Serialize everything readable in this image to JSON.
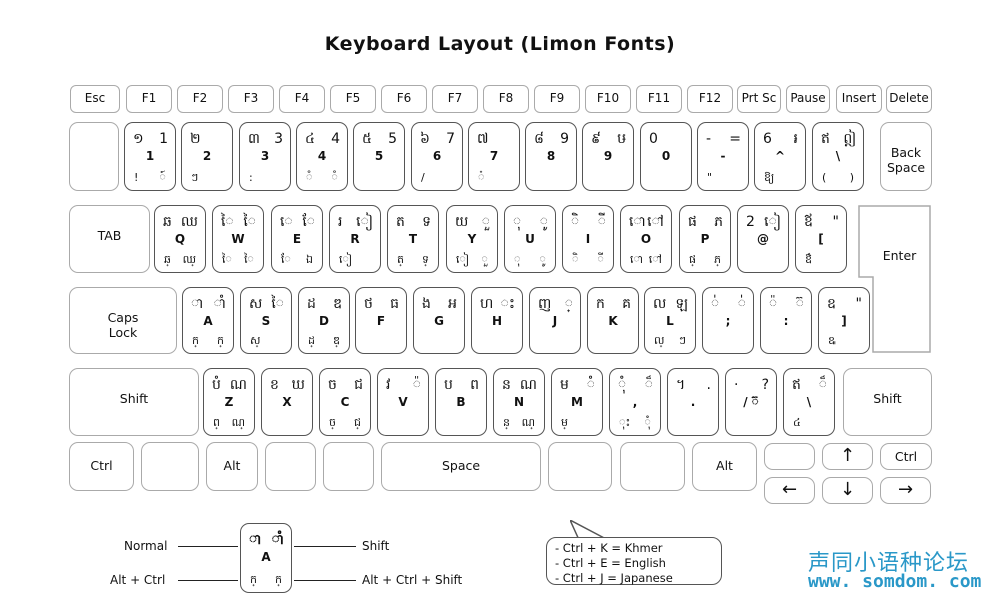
{
  "title": "Keyboard Layout  (Limon Fonts)",
  "function_row": [
    "Esc",
    "F1",
    "F2",
    "F3",
    "F4",
    "F5",
    "F6",
    "F7",
    "F8",
    "F9",
    "F10",
    "F11",
    "F12",
    "Prt Sc",
    "Pause",
    "Insert",
    "Delete"
  ],
  "number_row": [
    {
      "tl": "",
      "tr": "",
      "mid": "",
      "bl": "",
      "br": ""
    },
    {
      "tl": "១",
      "tr": "1",
      "mid": "1",
      "bl": "!",
      "br": "៍"
    },
    {
      "tl": "២",
      "tr": "",
      "mid": "2",
      "bl": "ៗ",
      "br": ""
    },
    {
      "tl": "៣",
      "tr": "3",
      "mid": "3",
      "bl": ":",
      "br": ""
    },
    {
      "tl": "៤",
      "tr": "4",
      "mid": "4",
      "bl": "៓",
      "br": "៓"
    },
    {
      "tl": "៥",
      "tr": "5",
      "mid": "5",
      "bl": "",
      "br": ""
    },
    {
      "tl": "៦",
      "tr": "7",
      "mid": "6",
      "bl": "/",
      "br": ""
    },
    {
      "tl": "៧",
      "tr": "",
      "mid": "7",
      "bl": "៎",
      "br": ""
    },
    {
      "tl": "៨",
      "tr": "9",
      "mid": "8",
      "bl": "",
      "br": ""
    },
    {
      "tl": "៩",
      "tr": "ឞ",
      "mid": "9",
      "bl": "",
      "br": ""
    },
    {
      "tl": "0",
      "tr": "",
      "mid": "0",
      "bl": "",
      "br": ""
    },
    {
      "tl": "-",
      "tr": "=",
      "mid": "-",
      "bl": "\"",
      "br": ""
    },
    {
      "tl": "6",
      "tr": "៛",
      "mid": "^",
      "bl": "ឱ្យ",
      "br": ""
    },
    {
      "tl": "ឥ",
      "tr": "ឦ",
      "mid": "\\",
      "bl": "(",
      "br": ")"
    }
  ],
  "backspace_label": "Back Space",
  "tab_label": "TAB",
  "qwerty_row": [
    {
      "tl": "ឆ",
      "tr": "ឈ",
      "mid": "Q",
      "bl": "ឆ្",
      "br": "ឈ្"
    },
    {
      "tl": "ៃ",
      "tr": "ៃ",
      "mid": "W",
      "bl": "ៃ",
      "br": "ៃ"
    },
    {
      "tl": "េ",
      "tr": "ែ",
      "mid": "E",
      "bl": "ែ",
      "br": "ឯ"
    },
    {
      "tl": "រ",
      "tr": "ៀ",
      "mid": "R",
      "bl": "ៀ",
      "br": ""
    },
    {
      "tl": "ត",
      "tr": "ទ",
      "mid": "T",
      "bl": "ត្",
      "br": "ទ្"
    },
    {
      "tl": "យ",
      "tr": "ួ",
      "mid": "Y",
      "bl": "ៀ",
      "br": "ួ"
    },
    {
      "tl": "ុ",
      "tr": "ូ",
      "mid": "U",
      "bl": "ុ",
      "br": "ូ"
    },
    {
      "tl": "ិ",
      "tr": "ី",
      "mid": "I",
      "bl": "ិ",
      "br": "ី"
    },
    {
      "tl": "ោ",
      "tr": "ៅ",
      "mid": "O",
      "bl": "ោ",
      "br": "ៅ"
    },
    {
      "tl": "ផ",
      "tr": "ភ",
      "mid": "P",
      "bl": "ផ្",
      "br": "ភ្"
    },
    {
      "tl": "2",
      "tr": "ៀ",
      "mid": "@",
      "bl": "",
      "br": ""
    },
    {
      "tl": "ឪ",
      "tr": "\"",
      "mid": "[",
      "bl": "ឳ",
      "br": ""
    }
  ],
  "enter_label": "Enter",
  "caps_label": "Caps Lock",
  "home_row": [
    {
      "tl": "ា",
      "tr": "ាំ",
      "mid": "A",
      "bl": "ក្",
      "br": "ក្"
    },
    {
      "tl": "ស",
      "tr": "ៃ",
      "mid": "S",
      "bl": "ស្",
      "br": ""
    },
    {
      "tl": "ដ",
      "tr": "ឌ",
      "mid": "D",
      "bl": "ដ្",
      "br": "ឌ្"
    },
    {
      "tl": "ថ",
      "tr": "ធ",
      "mid": "F",
      "bl": "",
      "br": ""
    },
    {
      "tl": "ង",
      "tr": "អ",
      "mid": "G",
      "bl": "",
      "br": ""
    },
    {
      "tl": "ហ",
      "tr": "ះ",
      "mid": "H",
      "bl": "",
      "br": ""
    },
    {
      "tl": "ញ",
      "tr": "្",
      "mid": "J",
      "bl": "",
      "br": ""
    },
    {
      "tl": "ក",
      "tr": "គ",
      "mid": "K",
      "bl": "",
      "br": ""
    },
    {
      "tl": "ល",
      "tr": "ឡ",
      "mid": "L",
      "bl": "ល្",
      "br": "ៗ"
    },
    {
      "tl": "់",
      "tr": "់",
      "mid": ";",
      "bl": "",
      "br": ""
    },
    {
      "tl": "៉",
      "tr": "៊",
      "mid": ":",
      "bl": "",
      "br": ""
    },
    {
      "tl": "ឧ",
      "tr": "\"",
      "mid": "]",
      "bl": "ឩ",
      "br": ""
    }
  ],
  "shift_label": "Shift",
  "bottom_row": [
    {
      "tl": "បំ",
      "tr": "ណ",
      "mid": "Z",
      "bl": "ព្",
      "br": "ណ្"
    },
    {
      "tl": "ខ",
      "tr": "ឃ",
      "mid": "X",
      "bl": "",
      "br": ""
    },
    {
      "tl": "ច",
      "tr": "ជ",
      "mid": "C",
      "bl": "ច្",
      "br": "ជ្"
    },
    {
      "tl": "វ",
      "tr": "៉",
      "mid": "V",
      "bl": "",
      "br": ""
    },
    {
      "tl": "ប",
      "tr": "ព",
      "mid": "B",
      "bl": "",
      "br": ""
    },
    {
      "tl": "ន",
      "tr": "ណ",
      "mid": "N",
      "bl": "ន្",
      "br": "ណ្"
    },
    {
      "tl": "ម",
      "tr": "ំ",
      "mid": "M",
      "bl": "ម្",
      "br": ""
    },
    {
      "tl": "ុំ",
      "tr": "៏",
      "mid": ",",
      "bl": "ុះ",
      "br": "ុំ"
    },
    {
      "tl": "។",
      "tr": ".",
      "mid": ".",
      "bl": "",
      "br": ""
    },
    {
      "tl": "·",
      "tr": "?",
      "mid": "/ ៊",
      "bl": "",
      "br": ""
    },
    {
      "tl": "ឥ",
      "tr": "៏",
      "mid": "\\",
      "bl": "៤",
      "br": ""
    }
  ],
  "ctrl_label": "Ctrl",
  "alt_label": "Alt",
  "space_label": "Space",
  "arrows": {
    "up": "↑",
    "down": "↓",
    "left": "←",
    "right": "→"
  },
  "legend": {
    "normal": "Normal",
    "shift": "Shift",
    "alt_ctrl": "Alt + Ctrl",
    "alt_ctrl_shift": "Alt + Ctrl + Shift",
    "key": {
      "tl": "ា",
      "tr": "ាំ",
      "mid": "A",
      "bl": "ក្",
      "br": "ក្"
    }
  },
  "shortcuts": [
    "- Ctrl + K = Khmer",
    "- Ctrl + E = English",
    "- Ctrl + J  = Japanese"
  ],
  "watermark": {
    "cn": "声同小语种论坛",
    "url": "www. somdom. com"
  }
}
